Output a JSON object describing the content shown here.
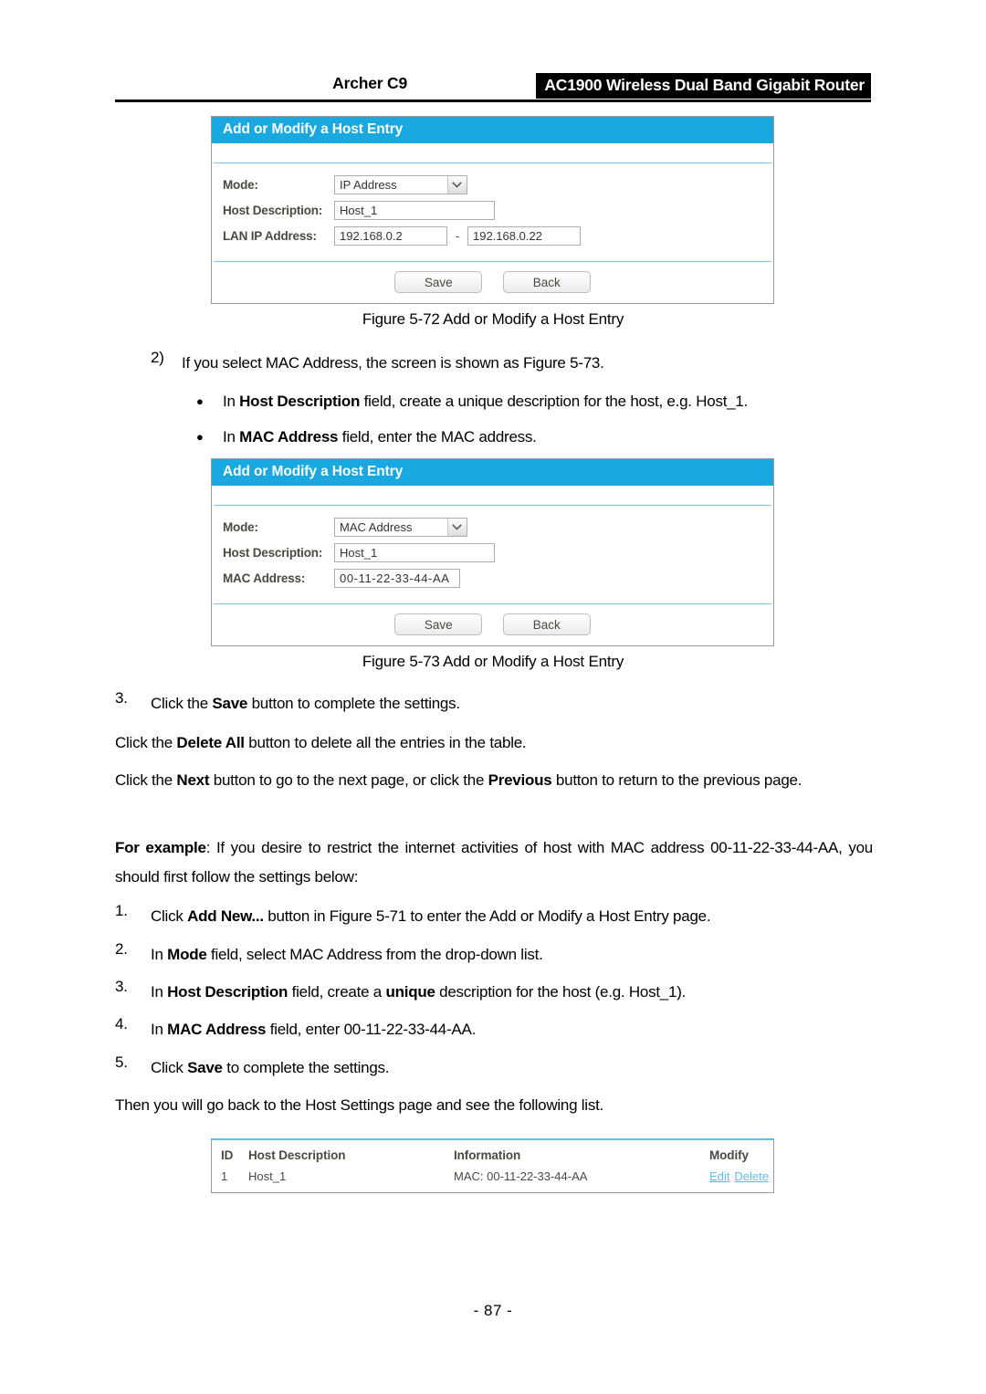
{
  "header": {
    "model": "Archer C9",
    "product": "AC1900 Wireless Dual Band Gigabit Router"
  },
  "figure_72": {
    "panel_title": "Add or Modify a Host Entry",
    "labels": {
      "mode": "Mode:",
      "host_description": "Host Description:",
      "lan_ip_address": "LAN IP Address:"
    },
    "values": {
      "mode": "IP Address",
      "host_description": "Host_1",
      "lan_ip_start": "192.168.0.2",
      "lan_ip_separator": "-",
      "lan_ip_end": "192.168.0.22"
    },
    "buttons": {
      "save": "Save",
      "back": "Back"
    },
    "caption": "Figure 5-72 Add or Modify a Host Entry"
  },
  "figure_73": {
    "panel_title": "Add or Modify a Host Entry",
    "labels": {
      "mode": "Mode:",
      "host_description": "Host Description:",
      "mac_address": "MAC Address:"
    },
    "values": {
      "mode": "MAC Address",
      "host_description": "Host_1",
      "mac_address": "00-11-22-33-44-AA"
    },
    "buttons": {
      "save": "Save",
      "back": "Back"
    },
    "caption": "Figure 5-73 Add or Modify a Host Entry"
  },
  "body": {
    "item2_num": "2)",
    "item2_text": "If you select MAC Address, the screen is shown as Figure 5-73.",
    "bullet_glyph": "●",
    "bullet1_pre": "In ",
    "bullet1_bold": "Host Description",
    "bullet1_post": " field, create a unique description for the host, e.g. Host_1.",
    "bullet2_pre": "In ",
    "bullet2_bold": "MAC Address",
    "bullet2_post": " field, enter the MAC address.",
    "item3_num": "3.",
    "item3_pre": "Click the ",
    "item3_bold": "Save",
    "item3_post": " button to complete the settings.",
    "para_delete_pre": "Click the ",
    "para_delete_bold": "Delete All",
    "para_delete_post": " button to delete all the entries in the table.",
    "para_next_pre": "Click the ",
    "para_next_bold1": "Next",
    "para_next_mid": " button to go to the next page, or click the ",
    "para_next_bold2": "Previous",
    "para_next_post": " button to return to the previous page.",
    "example_bold": "For example",
    "example_text": ": If you desire to restrict the internet activities of host with MAC address 00-11-22-33-44-AA, you should first follow the settings below:",
    "step1_num": "1.",
    "step1_pre": "Click ",
    "step1_bold": "Add New...",
    "step1_post": " button in Figure 5-71 to enter the Add or Modify a Host Entry page.",
    "step2_num": "2.",
    "step2_pre": "In ",
    "step2_bold": "Mode",
    "step2_post": " field, select MAC Address from the drop-down list.",
    "step3_num": "3.",
    "step3_pre": "In ",
    "step3_bold": "Host Description",
    "step3_mid": " field, create a ",
    "step3_bold2": "unique",
    "step3_post": " description for the host (e.g. Host_1).",
    "step4_num": "4.",
    "step4_pre": "In ",
    "step4_bold": "MAC Address",
    "step4_post": " field, enter 00-11-22-33-44-AA.",
    "step5_num": "5.",
    "step5_pre": "Click ",
    "step5_bold": "Save",
    "step5_post": " to complete the settings.",
    "closing": "Then you will go back to the Host Settings page and see the following list."
  },
  "host_list": {
    "columns": {
      "id": "ID",
      "host_description": "Host Description",
      "information": "Information",
      "modify": "Modify"
    },
    "rows": [
      {
        "id": "1",
        "host_description": "Host_1",
        "information": "MAC: 00-11-22-33-44-AA",
        "edit": "Edit",
        "delete": "Delete"
      }
    ]
  },
  "page_number": "- 87 -",
  "colors": {
    "panel_title_bg": "#19a8e0",
    "rule_blue": "#6ec6ea",
    "link_blue": "#5cbfe8",
    "label_text": "#4a4a3f"
  }
}
